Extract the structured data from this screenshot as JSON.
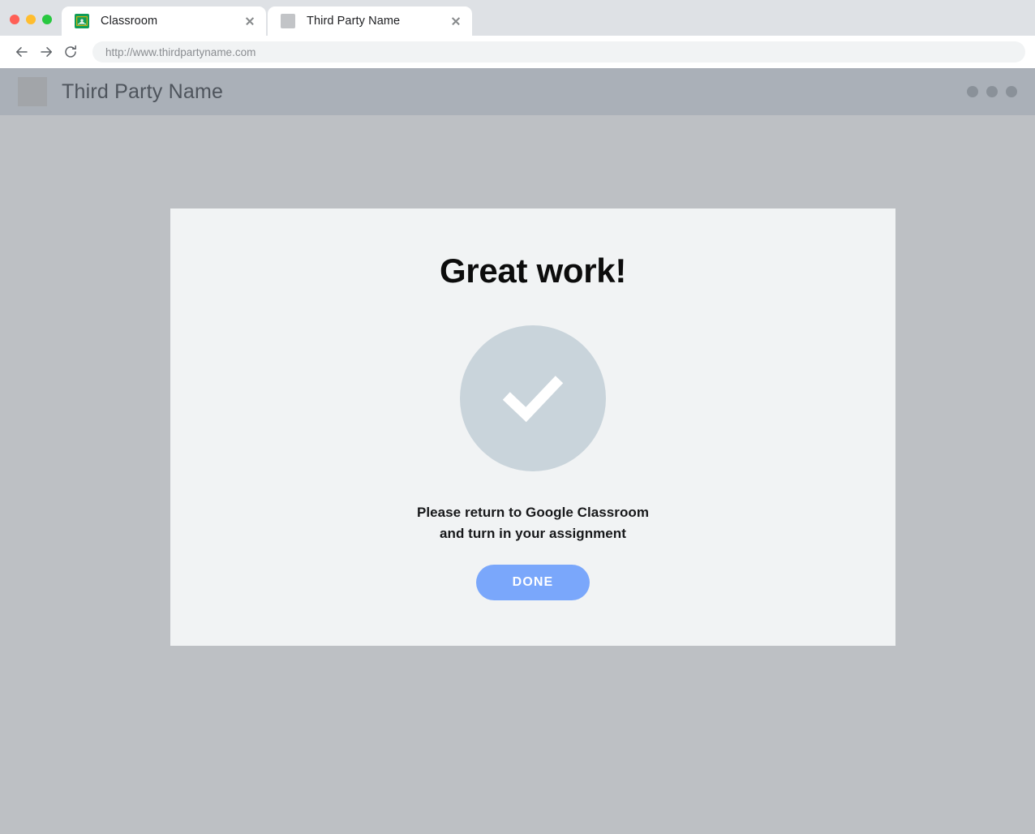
{
  "browser": {
    "window_controls": [
      {
        "name": "close",
        "color": "#ff5f56"
      },
      {
        "name": "minimize",
        "color": "#ffbd2e"
      },
      {
        "name": "maximize",
        "color": "#28c840"
      }
    ],
    "tabs": [
      {
        "title": "Classroom",
        "favicon": "google-classroom-icon",
        "active": true,
        "close_label": "×"
      },
      {
        "title": "Third Party Name",
        "favicon": "placeholder-square-icon",
        "active": false,
        "close_label": "×"
      }
    ],
    "toolbar": {
      "back_icon": "back-arrow-icon",
      "forward_icon": "forward-arrow-icon",
      "reload_icon": "reload-icon",
      "url": "http://www.thirdpartyname.com"
    }
  },
  "site": {
    "header": {
      "logo": "placeholder-logo-icon",
      "title": "Third Party Name",
      "menu_icon": "three-dots-icon",
      "background_color": "#aab0b8",
      "title_color": "#4e545c"
    },
    "page_background_color": "#bdc0c4"
  },
  "card": {
    "background_color": "#f1f3f4",
    "heading": "Great work!",
    "check_icon": "checkmark-icon",
    "check_circle_color": "#c9d4db",
    "check_mark_color": "#ffffff",
    "message_line_1": "Please return to Google Classroom",
    "message_line_2": "and turn in your assignment",
    "done_label": "DONE",
    "done_color": "#7aa7fb"
  }
}
